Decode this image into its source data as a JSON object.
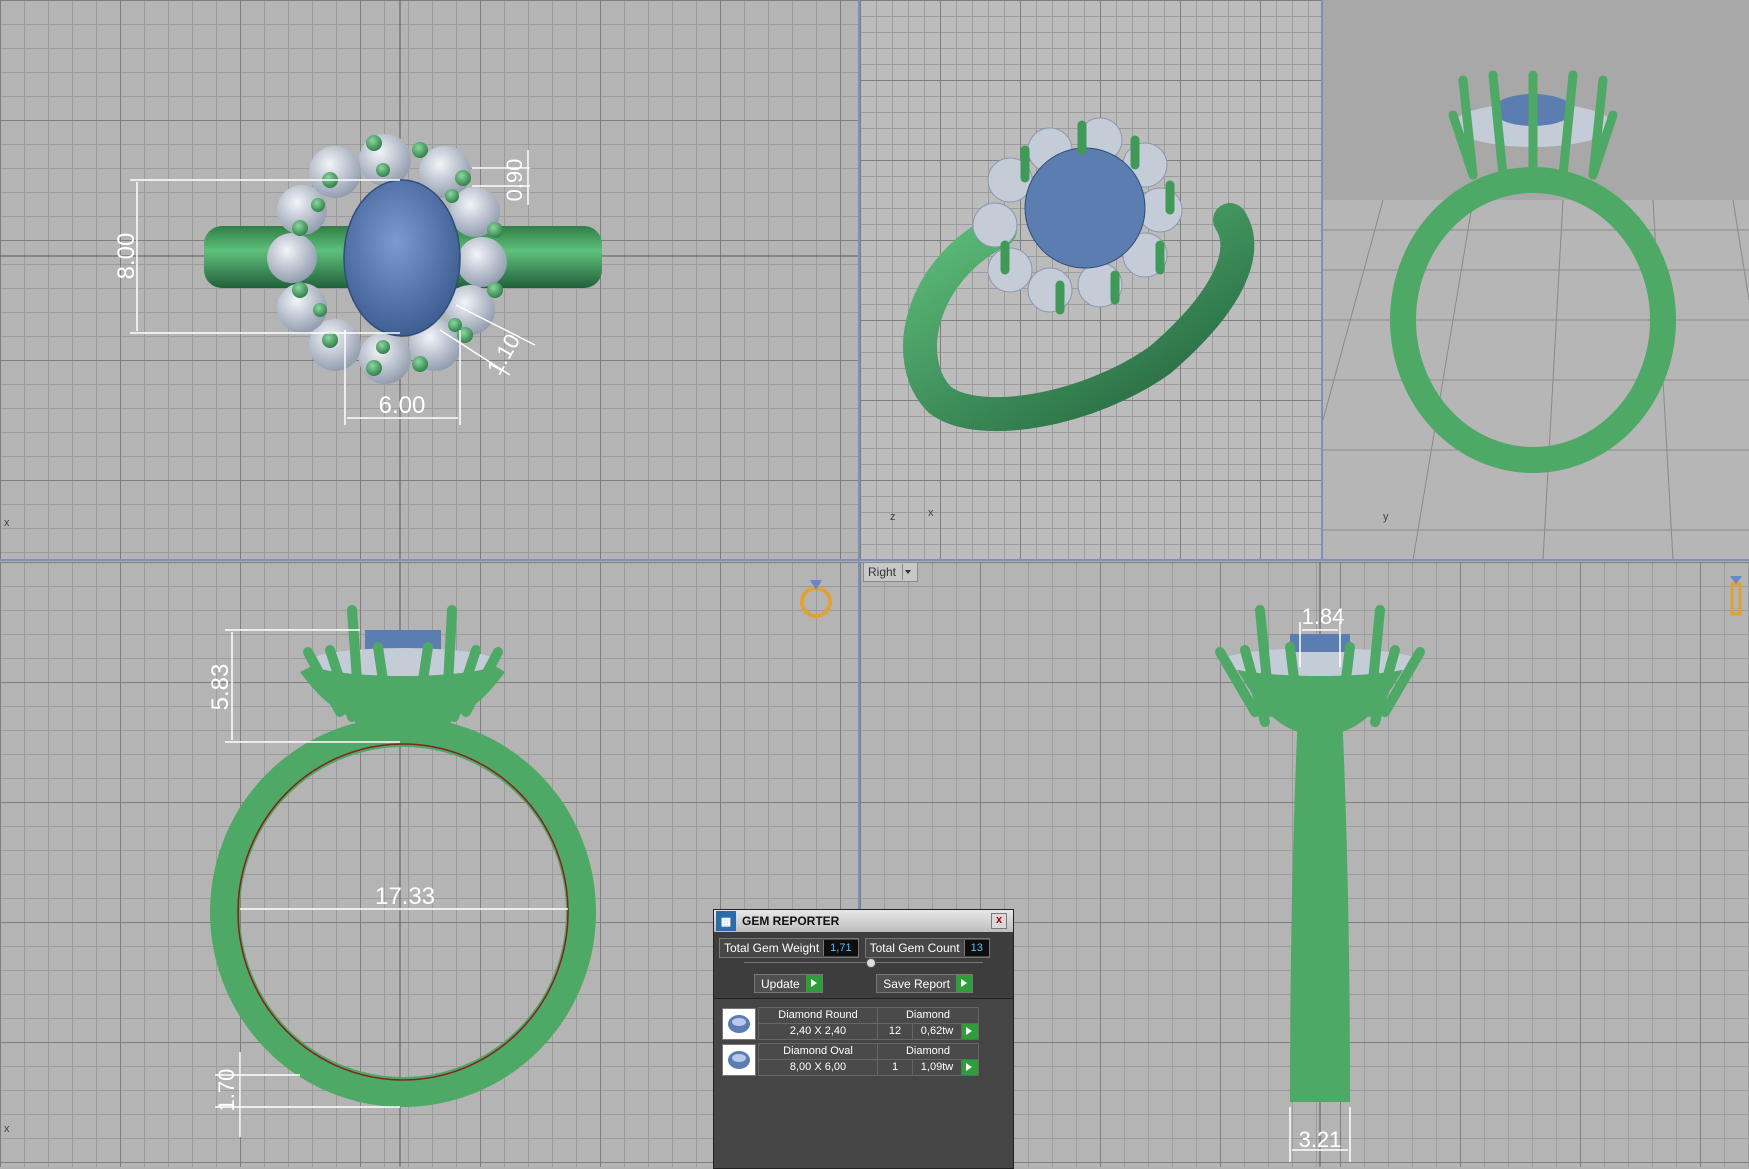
{
  "viewports": {
    "top": {
      "axis_label": "x",
      "dimensions": {
        "height": "8.00",
        "width": "6.00",
        "prong_small": "0.90",
        "prong_diag": "1.10"
      }
    },
    "perspective": {
      "axis_labels": {
        "x": "x",
        "y": "y",
        "z": "z"
      }
    },
    "front": {
      "axis_label": "x",
      "dimensions": {
        "head_height": "5.83",
        "inner_diameter": "17.33",
        "shank_thickness": "1.70"
      }
    },
    "right": {
      "view_label": "Right",
      "dimensions": {
        "top_width": "1.84",
        "bottom_width": "3.21"
      }
    }
  },
  "gem_reporter": {
    "title": "GEM REPORTER",
    "close": "x",
    "total_weight_label": "Total Gem Weight",
    "total_weight_value": "1,71",
    "total_count_label": "Total Gem Count",
    "total_count_value": "13",
    "update_label": "Update",
    "save_label": "Save Report",
    "gems": [
      {
        "name": "Diamond Round",
        "material": "Diamond",
        "size": "2,40 X 2,40",
        "count": "12",
        "weight": "0,62tw"
      },
      {
        "name": "Diamond Oval",
        "material": "Diamond",
        "size": "8,00 X 6,00",
        "count": "1",
        "weight": "1,09tw"
      }
    ]
  },
  "colors": {
    "metal": "#4ea866",
    "center_stone": "#5b7db0",
    "diamonds": "#c4ccd8",
    "grid_bg": "#b4b4b4",
    "stat_value": "#59c2ff"
  }
}
